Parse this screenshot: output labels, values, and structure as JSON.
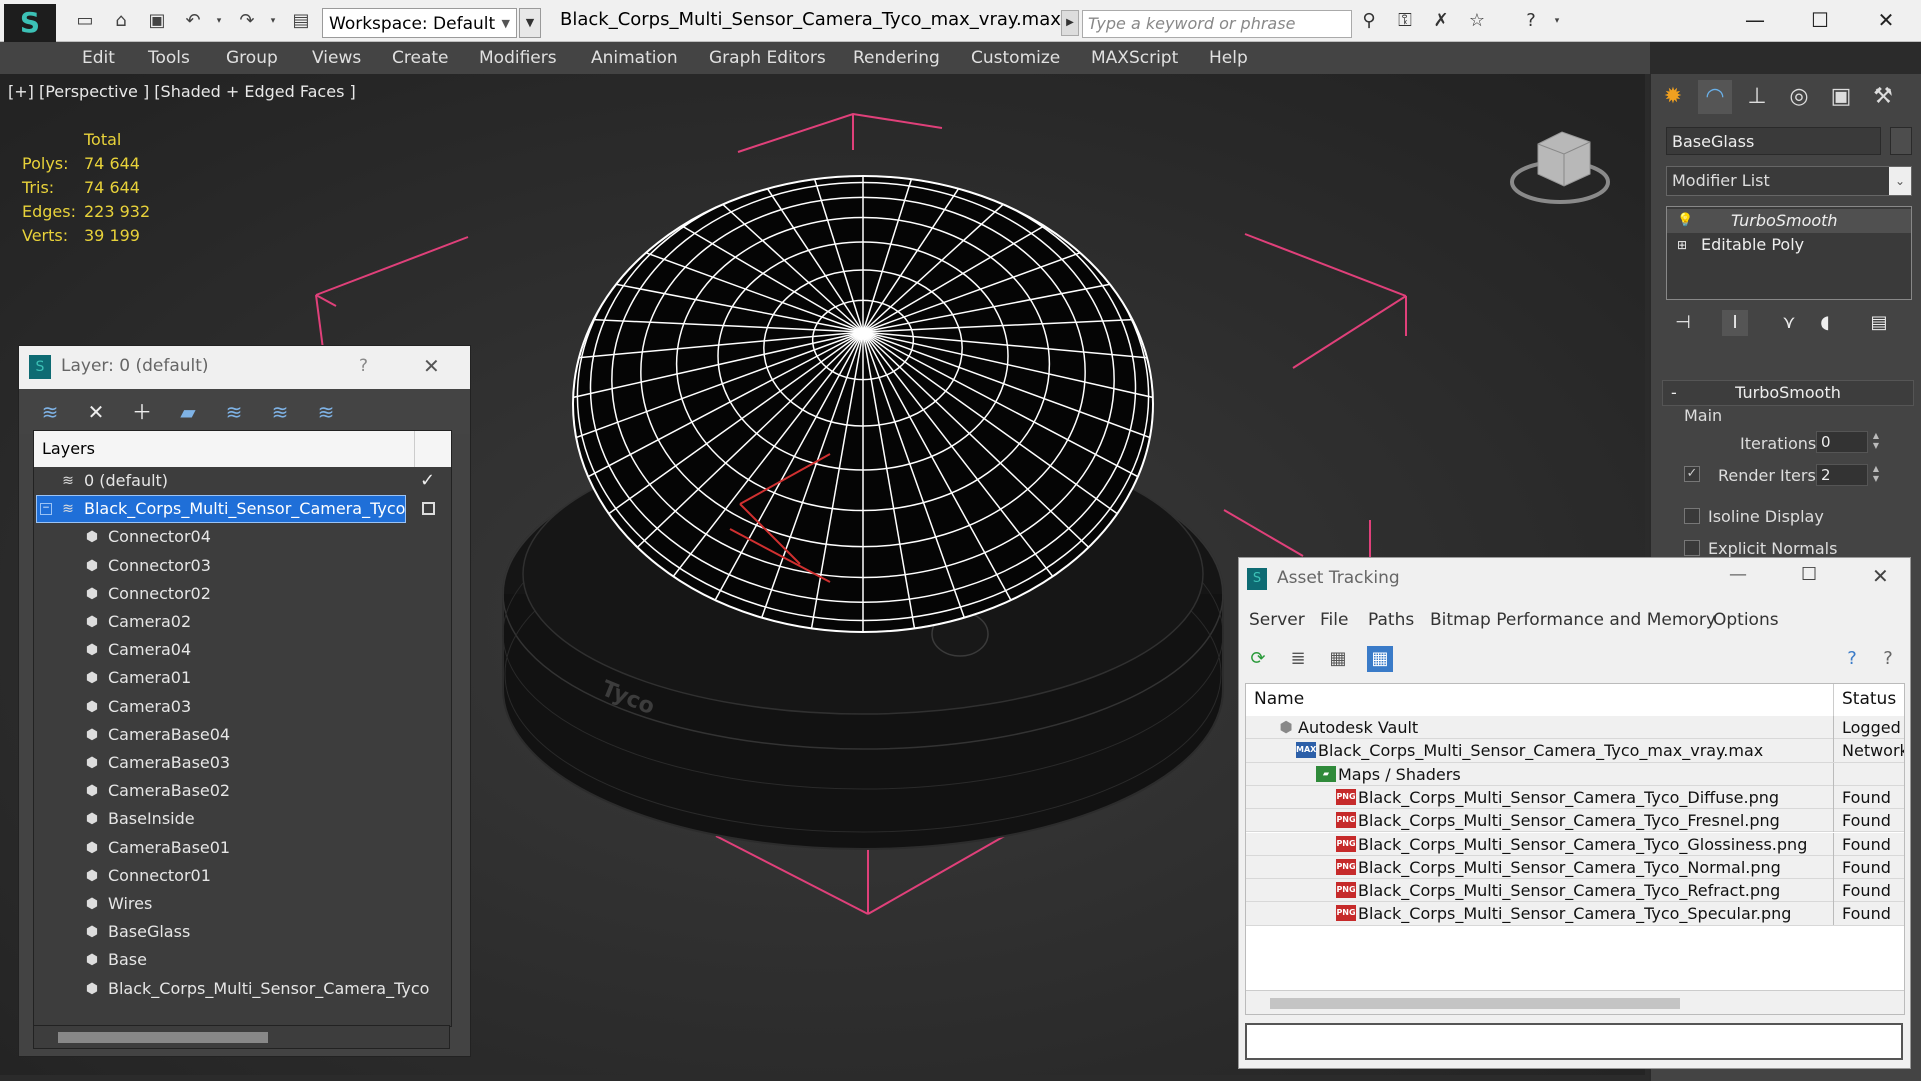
{
  "titlebar": {
    "workspace_label": "Workspace: Default",
    "file_title": "Black_Corps_Multi_Sensor_Camera_Tyco_max_vray.max",
    "search_placeholder": "Type a keyword or phrase"
  },
  "menubar": [
    "Edit",
    "Tools",
    "Group",
    "Views",
    "Create",
    "Modifiers",
    "Animation",
    "Graph Editors",
    "Rendering",
    "Customize",
    "MAXScript",
    "Help"
  ],
  "viewport": {
    "label": "[+] [Perspective ] [Shaded + Edged Faces ]",
    "stats": {
      "header": "Total",
      "rows": [
        {
          "label": "Polys:",
          "value": "74 644"
        },
        {
          "label": "Tris:",
          "value": "74 644"
        },
        {
          "label": "Edges:",
          "value": "223 932"
        },
        {
          "label": "Verts:",
          "value": "39 199"
        }
      ]
    },
    "product_text": "Tyco",
    "colors": {
      "wire_white": "#ffffff",
      "bbox_pink": "#e0407a",
      "axis_red": "#d03030",
      "stat_yellow": "#e8d23a"
    }
  },
  "command_panel": {
    "object_name": "BaseGlass",
    "modifier_list": "Modifier List",
    "stack": [
      "TurboSmooth",
      "Editable Poly"
    ],
    "rollout_title": "TurboSmooth",
    "group_main": "Main",
    "iterations_label": "Iterations:",
    "iterations_value": "0",
    "render_iters_label": "Render Iters:",
    "render_iters_value": "2",
    "render_iters_checked": true,
    "isoline_label": "Isoline Display",
    "explicit_normals_label": "Explicit Normals"
  },
  "layer_dialog": {
    "title": "Layer: 0 (default)",
    "help": "?",
    "column_header": "Layers",
    "rows": [
      {
        "name": "0 (default)",
        "kind": "layer",
        "indent": 0,
        "checked": true
      },
      {
        "name": "Black_Corps_Multi_Sensor_Camera_Tyco",
        "kind": "layer",
        "indent": 0,
        "selected": true
      },
      {
        "name": "Connector04",
        "kind": "object",
        "indent": 1
      },
      {
        "name": "Connector03",
        "kind": "object",
        "indent": 1
      },
      {
        "name": "Connector02",
        "kind": "object",
        "indent": 1
      },
      {
        "name": "Camera02",
        "kind": "object",
        "indent": 1
      },
      {
        "name": "Camera04",
        "kind": "object",
        "indent": 1
      },
      {
        "name": "Camera01",
        "kind": "object",
        "indent": 1
      },
      {
        "name": "Camera03",
        "kind": "object",
        "indent": 1
      },
      {
        "name": "CameraBase04",
        "kind": "object",
        "indent": 1
      },
      {
        "name": "CameraBase03",
        "kind": "object",
        "indent": 1
      },
      {
        "name": "CameraBase02",
        "kind": "object",
        "indent": 1
      },
      {
        "name": "BaseInside",
        "kind": "object",
        "indent": 1
      },
      {
        "name": "CameraBase01",
        "kind": "object",
        "indent": 1
      },
      {
        "name": "Connector01",
        "kind": "object",
        "indent": 1
      },
      {
        "name": "Wires",
        "kind": "object",
        "indent": 1
      },
      {
        "name": "BaseGlass",
        "kind": "object",
        "indent": 1
      },
      {
        "name": "Base",
        "kind": "object",
        "indent": 1
      },
      {
        "name": "Black_Corps_Multi_Sensor_Camera_Tyco",
        "kind": "object",
        "indent": 1
      }
    ]
  },
  "asset_dialog": {
    "title": "Asset Tracking",
    "menu": [
      "Server",
      "File",
      "Paths",
      "Bitmap Performance and Memory",
      "Options"
    ],
    "columns": {
      "name": "Name",
      "status": "Status"
    },
    "rows": [
      {
        "name": "Autodesk Vault",
        "status": "Logged Out",
        "indent": 0,
        "icon": "vault"
      },
      {
        "name": "Black_Corps_Multi_Sensor_Camera_Tyco_max_vray.max",
        "status": "Network",
        "indent": 1,
        "icon": "max"
      },
      {
        "name": "Maps / Shaders",
        "status": "",
        "indent": 2,
        "icon": "maps"
      },
      {
        "name": "Black_Corps_Multi_Sensor_Camera_Tyco_Diffuse.png",
        "status": "Found",
        "indent": 3,
        "icon": "png"
      },
      {
        "name": "Black_Corps_Multi_Sensor_Camera_Tyco_Fresnel.png",
        "status": "Found",
        "indent": 3,
        "icon": "png"
      },
      {
        "name": "Black_Corps_Multi_Sensor_Camera_Tyco_Glossiness.png",
        "status": "Found",
        "indent": 3,
        "icon": "png"
      },
      {
        "name": "Black_Corps_Multi_Sensor_Camera_Tyco_Normal.png",
        "status": "Found",
        "indent": 3,
        "icon": "png"
      },
      {
        "name": "Black_Corps_Multi_Sensor_Camera_Tyco_Refract.png",
        "status": "Found",
        "indent": 3,
        "icon": "png"
      },
      {
        "name": "Black_Corps_Multi_Sensor_Camera_Tyco_Specular.png",
        "status": "Found",
        "indent": 3,
        "icon": "png"
      }
    ],
    "png_badge": "PNG",
    "max_badge": "MAX"
  }
}
